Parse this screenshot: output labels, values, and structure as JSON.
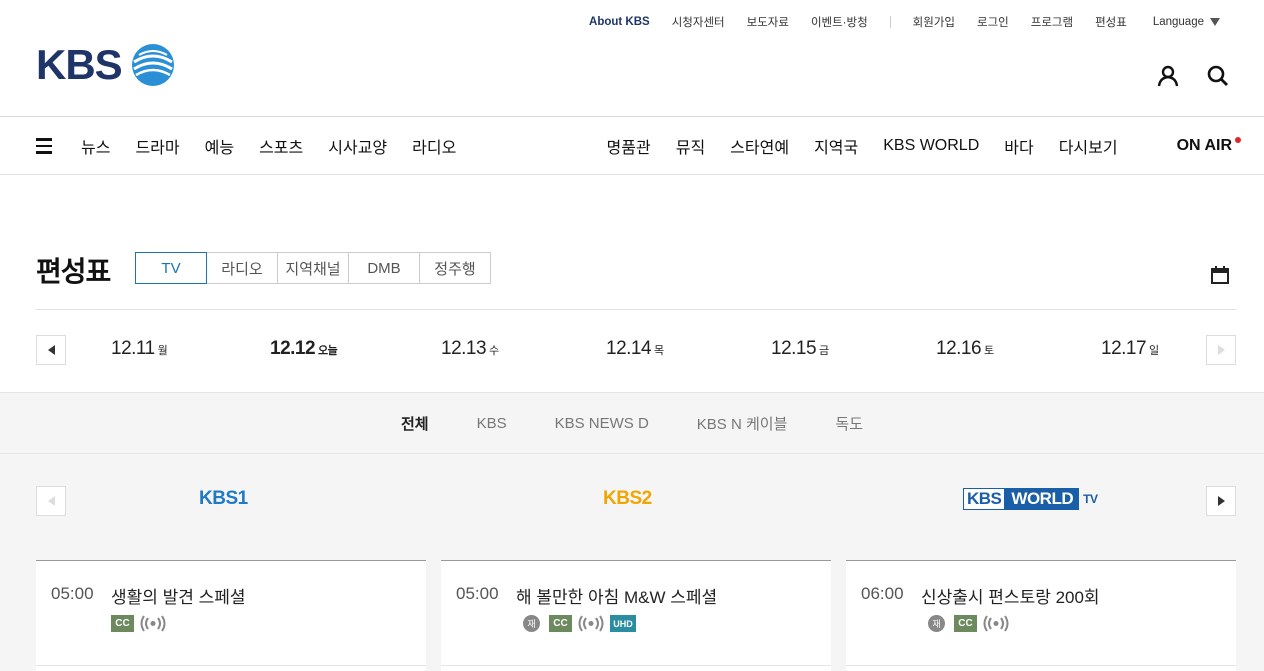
{
  "header": {
    "logo_text": "KBS",
    "utility_links": [
      "About KBS",
      "시청자센터",
      "보도자료",
      "이벤트·방청",
      "회원가입",
      "로그인",
      "프로그램",
      "편성표"
    ],
    "language_label": "Language"
  },
  "nav": {
    "left": [
      "뉴스",
      "드라마",
      "예능",
      "스포츠",
      "시사교양",
      "라디오"
    ],
    "right": [
      "명품관",
      "뮤직",
      "스타연예",
      "지역국",
      "KBS WORLD",
      "바다",
      "다시보기"
    ],
    "onair": "ON AIR"
  },
  "schedule": {
    "title": "편성표",
    "tabs": [
      "TV",
      "라디오",
      "지역채널",
      "DMB",
      "정주행"
    ],
    "active_tab": "TV",
    "dates": [
      {
        "date": "12.11",
        "day": "월"
      },
      {
        "date": "12.12",
        "day": "오늘"
      },
      {
        "date": "12.13",
        "day": "수"
      },
      {
        "date": "12.14",
        "day": "목"
      },
      {
        "date": "12.15",
        "day": "금"
      },
      {
        "date": "12.16",
        "day": "토"
      },
      {
        "date": "12.17",
        "day": "일"
      }
    ],
    "groups": [
      "전체",
      "KBS",
      "KBS NEWS D",
      "KBS N 케이블",
      "독도"
    ],
    "active_group": "전체"
  },
  "channels": [
    {
      "logo": "KBS1",
      "color": "#1f7ac6"
    },
    {
      "logo": "KBS2",
      "color": "#f0a500"
    },
    {
      "logo_a": "KBS",
      "logo_b": "WORLD",
      "logo_c": "TV",
      "color": "#1a5ea8"
    }
  ],
  "programs": [
    {
      "time": "05:00",
      "title": "생활의 발견 스페셜",
      "badges": [
        "CC",
        "radio"
      ]
    },
    {
      "time": "05:00",
      "title": "해 볼만한 아침 M&W 스페셜",
      "badges": [
        "재",
        "CC",
        "radio",
        "UHD"
      ]
    },
    {
      "time": "06:00",
      "title": "신상출시 편스토랑 200회",
      "badges": [
        "재",
        "CC",
        "radio"
      ]
    }
  ],
  "badge_labels": {
    "cc": "CC",
    "re": "재",
    "uhd": "UHD"
  },
  "colors": {
    "brand_navy": "#1f3568",
    "accent_blue": "#1a73b8",
    "onair_red": "#e4262b",
    "cc_green": "#6d8a5e",
    "uhd_teal": "#2a8ea0"
  }
}
